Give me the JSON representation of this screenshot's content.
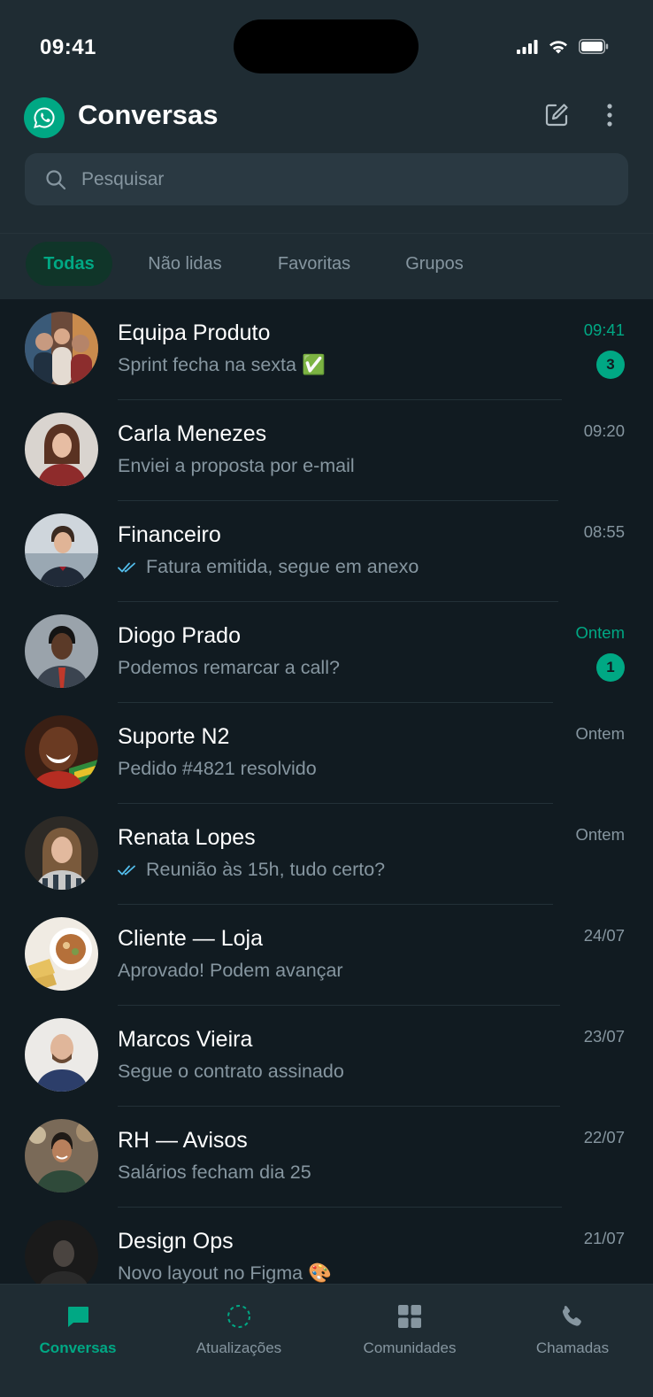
{
  "status_bar": {
    "time": "09:41"
  },
  "header": {
    "title": "Conversas"
  },
  "search": {
    "placeholder": "Pesquisar"
  },
  "tabs": [
    {
      "label": "Todas",
      "active": true
    },
    {
      "label": "Não lidas"
    },
    {
      "label": "Favoritas"
    },
    {
      "label": "Grupos"
    }
  ],
  "chats": [
    {
      "name": "Equipa Produto",
      "preview": "Sprint fecha na sexta ✅",
      "time": "09:41",
      "unread": "3",
      "time_unread": true
    },
    {
      "name": "Carla Menezes",
      "preview": "Enviei a proposta por e-mail",
      "time": "09:20"
    },
    {
      "name": "Financeiro",
      "preview": "Fatura emitida, segue em anexo",
      "time": "08:55",
      "read_ticks": true
    },
    {
      "name": "Diogo Prado",
      "preview": "Podemos remarcar a call?",
      "time": "Ontem",
      "unread": "1",
      "time_unread": true
    },
    {
      "name": "Suporte N2",
      "preview": "Pedido #4821 resolvido",
      "time": "Ontem"
    },
    {
      "name": "Renata Lopes",
      "preview": "Reunião às 15h, tudo certo?",
      "time": "Ontem",
      "read_ticks": true
    },
    {
      "name": "Cliente — Loja",
      "preview": "Aprovado! Podem avançar",
      "time": "24/07"
    },
    {
      "name": "Marcos Vieira",
      "preview": "Segue o contrato assinado",
      "time": "23/07"
    },
    {
      "name": "RH — Avisos",
      "preview": "Salários fecham dia 25",
      "time": "22/07"
    },
    {
      "name": "Design Ops",
      "preview": "Novo layout no Figma 🎨",
      "time": "21/07"
    }
  ],
  "bottom_nav": [
    {
      "label": "Conversas",
      "icon": "chat-icon",
      "active": true
    },
    {
      "label": "Atualizações",
      "icon": "status-icon"
    },
    {
      "label": "Comunidades",
      "icon": "communities-icon"
    },
    {
      "label": "Chamadas",
      "icon": "phone-icon"
    }
  ],
  "colors": {
    "background": "#111b21",
    "surface": "#1f2c33",
    "accent": "#00a884",
    "muted_text": "#8696a0",
    "read_tick": "#53bdeb"
  }
}
